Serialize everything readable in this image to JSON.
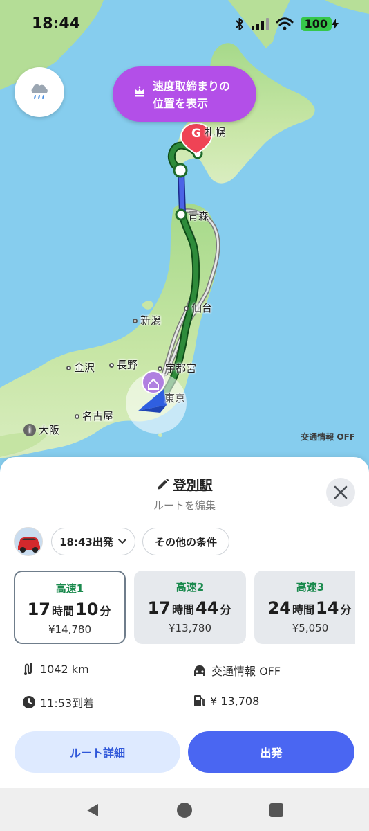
{
  "status_bar": {
    "time": "18:44",
    "battery": "100",
    "icons": [
      "bluetooth-icon",
      "signal-icon",
      "wifi-icon",
      "battery-charging-icon"
    ]
  },
  "map": {
    "weather_icon": "rain-cloud-icon",
    "speed_trap_button": {
      "line1": "速度取締まりの",
      "line2": "位置を表示",
      "icon": "crown-icon"
    },
    "goal_marker": "G",
    "cities": {
      "sapporo": "札幌",
      "aomori": "青森",
      "sendai": "仙台",
      "niigata": "新潟",
      "kanazawa": "金沢",
      "nagano": "長野",
      "utsunomiya": "宇都宮",
      "tokyo": "東京",
      "nagoya": "名古屋",
      "osaka": "大阪"
    },
    "traffic_toggle": "交通情報 OFF",
    "colors": {
      "route_main": "#2e7d32",
      "route_ferry": "#3f5bd8",
      "route_alt": "#9a9a9a",
      "speed_button": "#b34fe8",
      "goal": "#ef4355"
    }
  },
  "sheet": {
    "destination": "登別駅",
    "edit_route": "ルートを編集",
    "depart_pill": "18:43出発",
    "other_conditions": "その他の条件",
    "routes": [
      {
        "label": "高速1",
        "hours": "17",
        "h_unit": "時間",
        "minutes": "10",
        "m_unit": "分",
        "price": "¥14,780",
        "selected": true
      },
      {
        "label": "高速2",
        "hours": "17",
        "h_unit": "時間",
        "minutes": "44",
        "m_unit": "分",
        "price": "¥13,780",
        "selected": false
      },
      {
        "label": "高速3",
        "hours": "24",
        "h_unit": "時間",
        "minutes": "14",
        "m_unit": "分",
        "price": "¥5,050",
        "selected": false
      }
    ],
    "distance": "1042 km",
    "traffic_info": "交通情報 OFF",
    "arrival": "11:53到着",
    "fuel_cost": "¥ 13,708",
    "route_detail_button": "ルート詳細",
    "start_button": "出発",
    "colors": {
      "accent_blue": "#4a66f2",
      "route_label_green": "#1b8a4e"
    }
  },
  "navbar": {
    "icons": [
      "back-icon",
      "home-icon",
      "recents-icon"
    ]
  }
}
